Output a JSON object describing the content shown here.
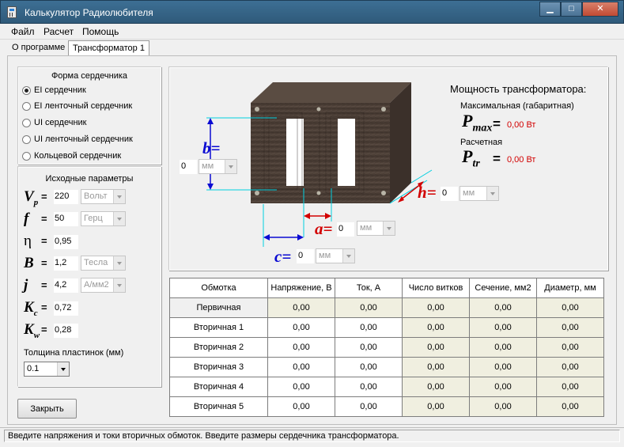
{
  "window": {
    "title": "Калькулятор Радиолюбителя",
    "minimize": "▁",
    "restore": "□",
    "close": "✕"
  },
  "menu": [
    "Файл",
    "Расчет",
    "Помощь"
  ],
  "tabs": [
    "О программе",
    "Трансформатор 1"
  ],
  "core_shape": {
    "title": "Форма сердечника",
    "options": [
      "EI сердечник",
      "EI ленточный сердечник",
      "UI сердечник",
      "UI ленточный сердечник",
      "Кольцевой сердечник"
    ],
    "selected_index": 0
  },
  "params": {
    "title": "Исходные параметры",
    "rows": [
      {
        "sym": "V",
        "sub": "p",
        "value": "220",
        "unit": "Вольт"
      },
      {
        "sym": "f",
        "sub": "",
        "value": "50",
        "unit": "Герц"
      },
      {
        "sym": "η",
        "sub": "",
        "value": "0,95",
        "unit": ""
      },
      {
        "sym": "B",
        "sub": "",
        "value": "1,2",
        "unit": "Тесла"
      },
      {
        "sym": "j",
        "sub": "",
        "value": "4,2",
        "unit": "А/мм2"
      },
      {
        "sym": "K",
        "sub": "c",
        "value": "0,72",
        "unit": ""
      },
      {
        "sym": "K",
        "sub": "w",
        "value": "0,28",
        "unit": ""
      }
    ],
    "eq": "=",
    "thickness_label": "Толщина пластинок (мм)",
    "thickness_value": "0.1"
  },
  "close_button": "Закрыть",
  "diagram": {
    "b": {
      "label": "b",
      "value": "0",
      "unit": "мм"
    },
    "h": {
      "label": "h",
      "value": "0",
      "unit": "мм"
    },
    "a": {
      "label": "a",
      "value": "0",
      "unit": "мм"
    },
    "c": {
      "label": "c",
      "value": "0",
      "unit": "мм"
    },
    "eq": "=",
    "colors": {
      "b": "#0a0ad2",
      "c": "#0a0ad2",
      "a": "#d20000",
      "h": "#d20000",
      "core": "#4a3d35"
    }
  },
  "power": {
    "title": "Мощность трансформатора:",
    "max_label": "Максимальная (габаритная)",
    "max_sym": "P",
    "max_sub": "max",
    "max_value": "0,00 Вт",
    "calc_label": "Расчетная",
    "calc_sym": "P",
    "calc_sub": "tr",
    "calc_value": "0,00 Вт",
    "eq": "="
  },
  "table": {
    "headers": [
      "Обмотка",
      "Напряжение, В",
      "Ток, А",
      "Число витков",
      "Сечение, мм2",
      "Диаметр, мм"
    ],
    "rows": [
      [
        "Первичная",
        "0,00",
        "0,00",
        "0,00",
        "0,00",
        "0,00"
      ],
      [
        "Вторичная 1",
        "0,00",
        "0,00",
        "0,00",
        "0,00",
        "0,00"
      ],
      [
        "Вторичная 2",
        "0,00",
        "0,00",
        "0,00",
        "0,00",
        "0,00"
      ],
      [
        "Вторичная 3",
        "0,00",
        "0,00",
        "0,00",
        "0,00",
        "0,00"
      ],
      [
        "Вторичная 4",
        "0,00",
        "0,00",
        "0,00",
        "0,00",
        "0,00"
      ],
      [
        "Вторичная 5",
        "0,00",
        "0,00",
        "0,00",
        "0,00",
        "0,00"
      ]
    ]
  },
  "status": "Введите напряжения и токи вторичных обмоток. Введите размеры сердечника трансформатора."
}
